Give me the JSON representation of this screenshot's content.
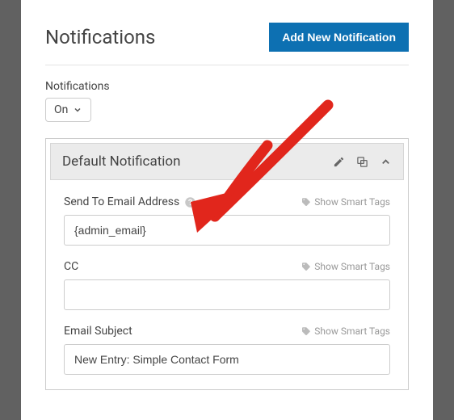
{
  "header": {
    "title": "Notifications",
    "add_button_label": "Add New Notification"
  },
  "toggle": {
    "label": "Notifications",
    "value": "On"
  },
  "panel": {
    "title": "Default Notification",
    "fields": {
      "send_to": {
        "label": "Send To Email Address",
        "smart_tags": "Show Smart Tags",
        "value": "{admin_email}"
      },
      "cc": {
        "label": "CC",
        "smart_tags": "Show Smart Tags",
        "value": ""
      },
      "subject": {
        "label": "Email Subject",
        "smart_tags": "Show Smart Tags",
        "value": "New Entry: Simple Contact Form"
      }
    }
  }
}
